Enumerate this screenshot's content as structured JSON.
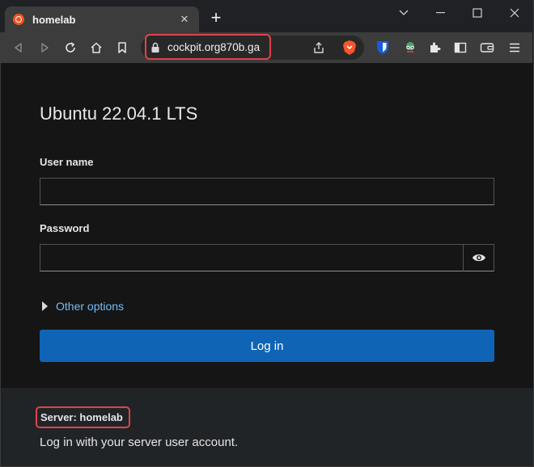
{
  "browser": {
    "tab": {
      "title": "homelab",
      "close_glyph": "✕",
      "favicon": "ubuntu-icon"
    },
    "new_tab_glyph": "+",
    "url": "cockpit.org870b.ga",
    "toolbar_icons": [
      "back-icon",
      "forward-icon",
      "reload-icon",
      "home-icon",
      "bookmark-icon",
      "lock-icon",
      "share-icon",
      "brave-icon",
      "bitwarden-icon",
      "extension-avatar-icon",
      "extensions-icon",
      "sidebar-icon",
      "wallet-icon",
      "menu-icon"
    ],
    "colors": {
      "highlight": "#e0434b",
      "brand_blue": "#0f64b5",
      "link": "#73bcf7"
    }
  },
  "login": {
    "os_title": "Ubuntu 22.04.1 LTS",
    "username_label": "User name",
    "username_value": "",
    "password_label": "Password",
    "password_value": "",
    "other_options": "Other options",
    "login_button": "Log in"
  },
  "footer": {
    "server_label": "Server: homelab",
    "help_text": "Log in with your server user account."
  }
}
